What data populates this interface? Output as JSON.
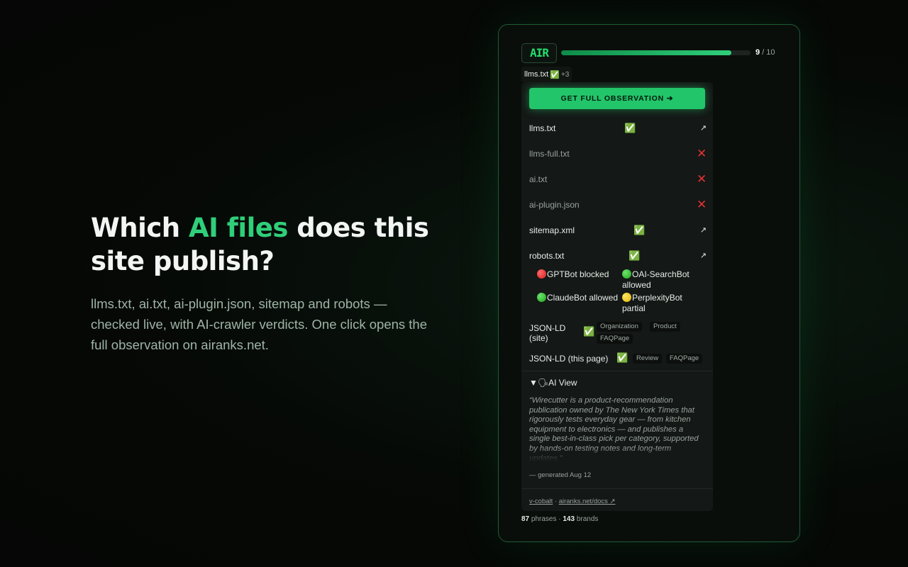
{
  "hero": {
    "title_pre": "Which ",
    "title_accent": "AI files",
    "title_post": " does this site publish?",
    "subtitle": "llms.txt, ai.txt, ai-plugin.json, sitemap and robots — checked live, with AI-crawler verdicts. One click opens the full observation on airanks.net."
  },
  "widget": {
    "logo": "AIR",
    "progress": {
      "value": 9,
      "max": 10,
      "fraction": 0.9
    },
    "score_value": "9",
    "score_sep": " / 10",
    "chip": {
      "label": "llms.txt",
      "status": "✅",
      "extra": "+3"
    },
    "cta_label": "GET FULL OBSERVATION ➔",
    "files": [
      {
        "name": "llms.txt",
        "status": "✅",
        "link": "↗",
        "found": true
      },
      {
        "name": "llms-full.txt",
        "status": "✕",
        "link": "",
        "found": false
      },
      {
        "name": "ai.txt",
        "status": "✕",
        "link": "",
        "found": false
      },
      {
        "name": "ai-plugin.json",
        "status": "✕",
        "link": "",
        "found": false
      },
      {
        "name": "sitemap.xml",
        "status": "✅",
        "link": "↗",
        "found": true
      },
      {
        "name": "robots.txt",
        "status": "✅",
        "link": "↗",
        "found": true
      }
    ],
    "bots": [
      {
        "label": "GPTBot blocked",
        "state": "red"
      },
      {
        "label": "OAI-SearchBot allowed",
        "state": "green"
      },
      {
        "label": "ClaudeBot allowed",
        "state": "green"
      },
      {
        "label": "PerplexityBot partial",
        "state": "yellow"
      }
    ],
    "jsonld_site": {
      "label": "JSON-LD (site)",
      "status": "✅",
      "tags": [
        "Organization",
        "Product",
        "FAQPage"
      ]
    },
    "jsonld_page": {
      "label": "JSON-LD (this page)",
      "status": "✅",
      "tags": [
        "Review",
        "FAQPage"
      ]
    },
    "ai_view": {
      "toggle": "▼",
      "icon": "🗣",
      "label": "AI View",
      "quote": "“Wirecutter is a product-recommendation publication owned by The New York Times that rigorously tests everyday gear — from kitchen equipment to electronics — and publishes a single best-in-class pick per category, supported by hands-on testing notes and long-term updates.”",
      "generated": "— generated Aug 12"
    },
    "footer": {
      "version": "v-cobalt",
      "sep": " · ",
      "docs": "airanks.net/docs ↗"
    },
    "stats": {
      "phrases": "87",
      "phrases_label": " phrases · ",
      "brands": "143",
      "brands_label": " brands"
    },
    "colors": {
      "accent": "#2fcf7a",
      "cta": "#22c569",
      "error": "#e23232"
    }
  }
}
